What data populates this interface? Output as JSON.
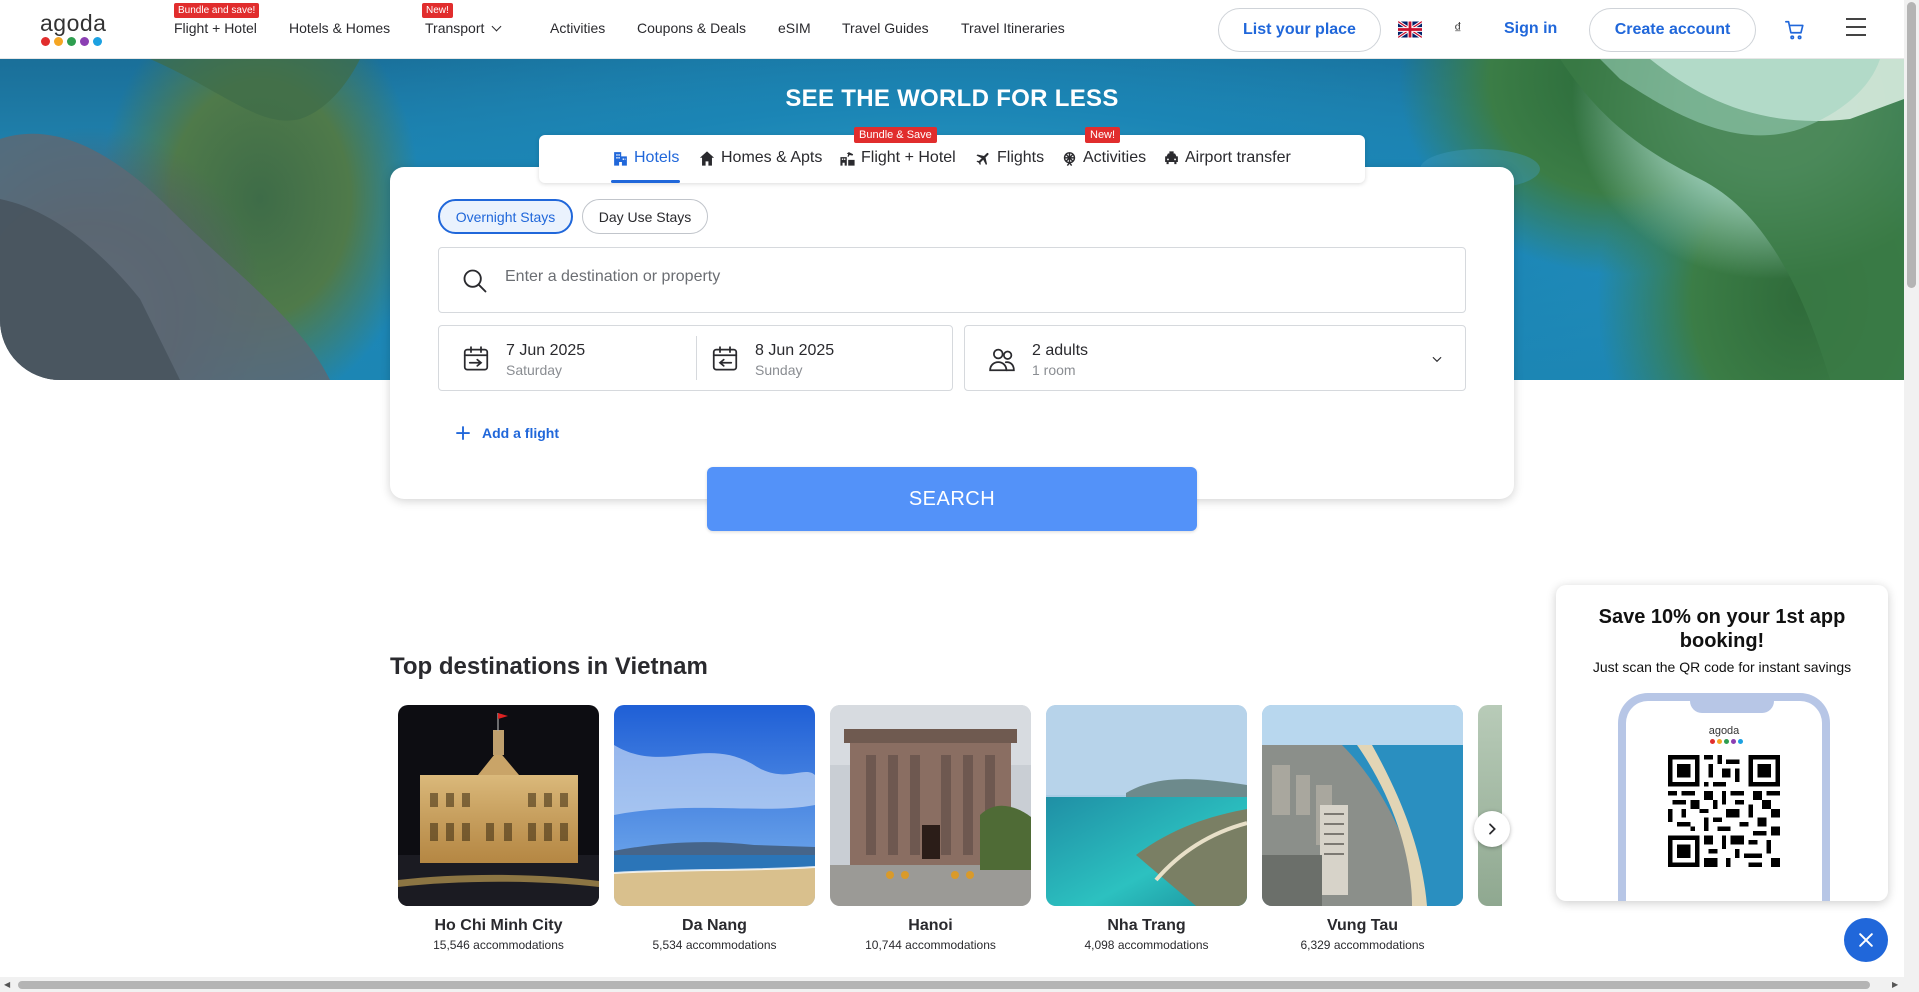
{
  "header": {
    "logo_text": "agoda",
    "logo_colors": [
      "#e12d2d",
      "#f5a623",
      "#2e9e4f",
      "#8b3fb3",
      "#1ca1e1"
    ],
    "nav": [
      {
        "label": "Flight + Hotel",
        "badge": "Bundle and save!"
      },
      {
        "label": "Hotels & Homes",
        "badge": ""
      },
      {
        "label": "Transport",
        "badge": "New!"
      },
      {
        "label": "Activities",
        "badge": ""
      },
      {
        "label": "Coupons & Deals",
        "badge": ""
      },
      {
        "label": "eSIM",
        "badge": ""
      },
      {
        "label": "Travel Guides",
        "badge": ""
      },
      {
        "label": "Travel Itineraries",
        "badge": ""
      }
    ],
    "list_place": "List your place",
    "currency": "₫",
    "sign_in": "Sign in",
    "create_account": "Create account"
  },
  "hero": {
    "title": "SEE THE WORLD FOR LESS"
  },
  "tabs": [
    {
      "label": "Hotels",
      "badge": "",
      "icon": "hotel-icon"
    },
    {
      "label": "Homes & Apts",
      "badge": "",
      "icon": "home-icon"
    },
    {
      "label": "Flight + Hotel",
      "badge": "Bundle & Save",
      "icon": "flight-hotel-icon"
    },
    {
      "label": "Flights",
      "badge": "",
      "icon": "plane-icon"
    },
    {
      "label": "Activities",
      "badge": "New!",
      "icon": "activities-icon"
    },
    {
      "label": "Airport transfer",
      "badge": "",
      "icon": "car-icon"
    }
  ],
  "search": {
    "stay_types": [
      "Overnight Stays",
      "Day Use Stays"
    ],
    "destination_placeholder": "Enter a destination or property",
    "checkin_date": "7 Jun 2025",
    "checkin_day": "Saturday",
    "checkout_date": "8 Jun 2025",
    "checkout_day": "Sunday",
    "guests": "2 adults",
    "rooms": "1 room",
    "add_flight": "Add a flight",
    "button": "SEARCH"
  },
  "destinations": {
    "title": "Top destinations in Vietnam",
    "items": [
      {
        "name": "Ho Chi Minh City",
        "count": "15,546 accommodations"
      },
      {
        "name": "Da Nang",
        "count": "5,534 accommodations"
      },
      {
        "name": "Hanoi",
        "count": "10,744 accommodations"
      },
      {
        "name": "Nha Trang",
        "count": "4,098 accommodations"
      },
      {
        "name": "Vung Tau",
        "count": "6,329 accommodations"
      }
    ]
  },
  "promo": {
    "title": "Save 10% on your 1st app booking!",
    "subtitle": "Just scan the QR code for instant savings",
    "app_logo": "agoda"
  },
  "colors": {
    "accent": "#2067da",
    "search_button": "#5392f9",
    "badge": "#e12d2d"
  }
}
